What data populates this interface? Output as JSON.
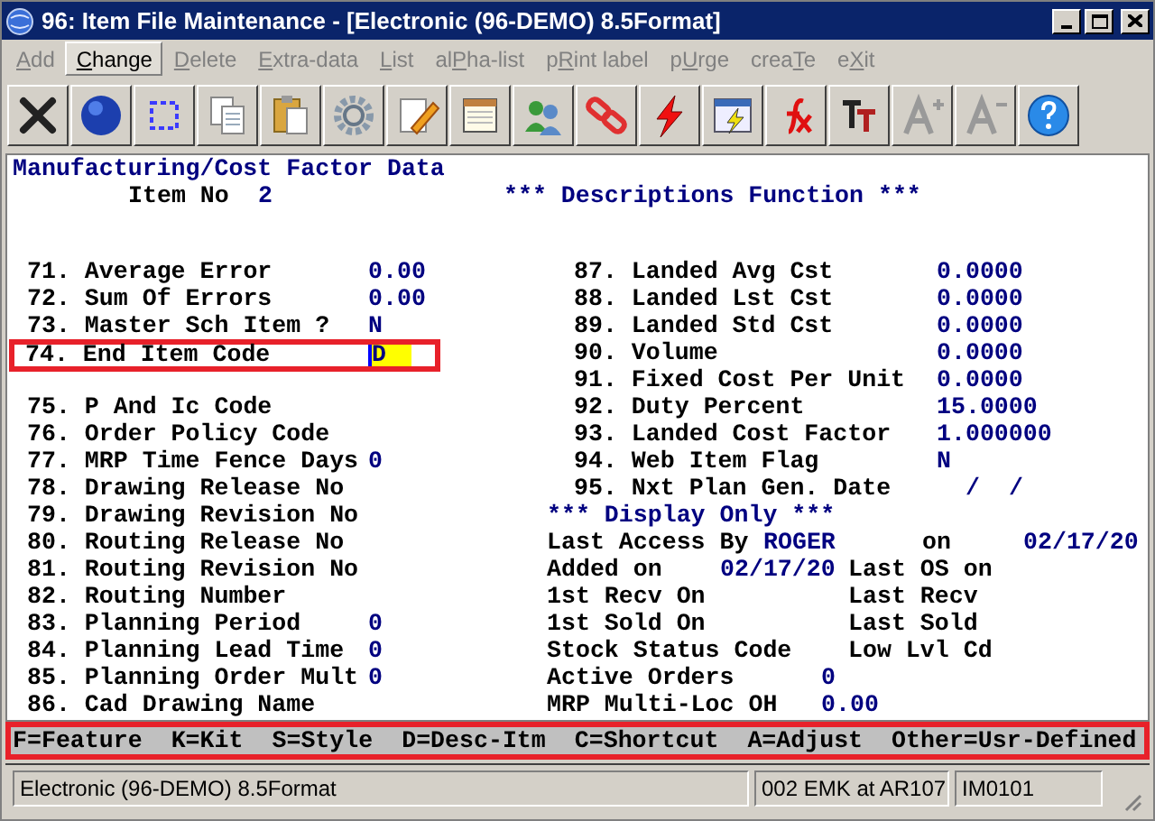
{
  "window": {
    "title": "96: Item File Maintenance - [Electronic (96-DEMO) 8.5Format]"
  },
  "menu": [
    {
      "mnemonic": "A",
      "label_end": "dd",
      "disabled": true,
      "selected": false
    },
    {
      "mnemonic": "C",
      "label_end": "hange",
      "disabled": false,
      "selected": true
    },
    {
      "mnemonic": "D",
      "label_end": "elete",
      "disabled": true,
      "selected": false
    },
    {
      "mnemonic": "E",
      "label_end": "xtra-data",
      "disabled": true,
      "selected": false
    },
    {
      "mnemonic": "L",
      "label_end": "ist",
      "disabled": true,
      "selected": false
    },
    {
      "label_start": "al",
      "mnemonic": "P",
      "label_end": "ha-list",
      "disabled": true,
      "selected": false
    },
    {
      "label_start": "p",
      "mnemonic": "R",
      "label_end": "int label",
      "disabled": true,
      "selected": false
    },
    {
      "label_start": "p",
      "mnemonic": "U",
      "label_end": "rge",
      "disabled": true,
      "selected": false
    },
    {
      "label_start": "crea",
      "mnemonic": "T",
      "label_end": "e",
      "disabled": true,
      "selected": false
    },
    {
      "label_start": "e",
      "mnemonic": "X",
      "label_end": "it",
      "disabled": true,
      "selected": false
    }
  ],
  "screen": {
    "heading": "Manufacturing/Cost Factor Data",
    "item_label": "Item No",
    "item_value": "2",
    "function_title": "*** Descriptions Function ***",
    "left_fields": [
      {
        "label": "71. Average Error",
        "value": "0.00",
        "current": false
      },
      {
        "label": "72. Sum Of Errors",
        "value": "0.00",
        "current": false
      },
      {
        "label": "73. Master Sch Item ?",
        "value": "N",
        "current": false
      },
      {
        "label": "74. End Item Code",
        "value": "D",
        "current": true
      },
      {
        "label": "75. P And Ic Code",
        "current": false
      },
      {
        "label": "76. Order Policy Code",
        "current": false
      },
      {
        "label": "77. MRP Time Fence Days",
        "value": "0",
        "current": false
      },
      {
        "label": "78. Drawing Release No",
        "current": false
      },
      {
        "label": "79. Drawing Revision No",
        "current": false
      },
      {
        "label": "80. Routing Release No",
        "current": false
      },
      {
        "label": "81. Routing Revision No",
        "current": false
      },
      {
        "label": "82. Routing Number",
        "current": false
      },
      {
        "label": "83. Planning Period",
        "value": "0",
        "current": false
      },
      {
        "label": "84. Planning Lead Time",
        "value": "0",
        "current": false
      },
      {
        "label": "85. Planning Order Mult",
        "value": "0",
        "current": false
      },
      {
        "label": "86. Cad Drawing Name",
        "current": false
      }
    ],
    "right_fields": [
      {
        "label": "87. Landed Avg Cst",
        "value": "0.0000",
        "kind": "number"
      },
      {
        "label": "88. Landed Lst Cst",
        "value": "0.0000",
        "kind": "number"
      },
      {
        "label": "89. Landed Std Cst",
        "value": "0.0000",
        "kind": "number"
      },
      {
        "label": "90. Volume",
        "value": "0.0000",
        "kind": "number"
      },
      {
        "label": "91. Fixed Cost Per Unit",
        "value": "0.0000",
        "kind": "number"
      },
      {
        "label": "92. Duty Percent",
        "value": "15.0000",
        "kind": "number"
      },
      {
        "label": "93. Landed Cost Factor",
        "value": "1.000000",
        "kind": "number"
      },
      {
        "label": "94. Web Item Flag",
        "value": "N",
        "kind": "number"
      },
      {
        "label": "95. Nxt Plan Gen. Date",
        "value": "/  /",
        "kind": "date"
      }
    ],
    "display_title": "*** Display Only ***",
    "display_only": [
      {
        "label": "Last Access By",
        "value": "ROGER",
        "label2": "on",
        "value2": "02/17/20"
      },
      {
        "label": "Added on",
        "value": "02/17/20",
        "label2": "Last OS on"
      },
      {
        "label": "1st Recv On",
        "label2": "Last Recv"
      },
      {
        "label": "1st Sold On",
        "label2": "Last Sold"
      },
      {
        "label": "Stock Status Code",
        "label2": "Low Lvl Cd"
      },
      {
        "label": "Active Orders",
        "value": "0"
      },
      {
        "label": "MRP Multi-Loc OH",
        "value": "0.00"
      }
    ]
  },
  "function_keys": [
    "F=Feature",
    "K=Kit",
    "S=Style",
    "D=Desc-Itm",
    "C=Shortcut",
    "A=Adjust",
    "Other=Usr-Defined"
  ],
  "status_bar": [
    "Electronic (96-DEMO) 8.5Format",
    "002 EMK at AR107",
    "IM0101"
  ]
}
